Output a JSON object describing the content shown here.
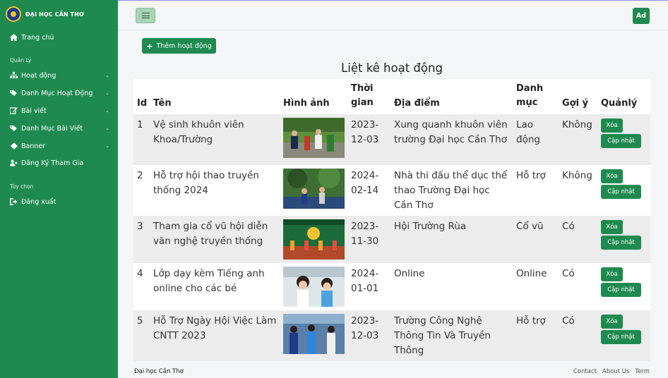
{
  "brand": {
    "name": "ĐẠI HỌC CẦN THƠ"
  },
  "sidebar": {
    "home": "Trang chủ",
    "section_manage": "Quản Lý",
    "items": [
      {
        "label": "Hoạt động",
        "icon": "sitemap-icon"
      },
      {
        "label": "Danh Mục Hoạt Động",
        "icon": "tag-icon"
      },
      {
        "label": "Bài viết",
        "icon": "edit-icon"
      },
      {
        "label": "Danh Mục Bài Viết",
        "icon": "tag-icon"
      },
      {
        "label": "Banner",
        "icon": "diamond-icon"
      },
      {
        "label": "Đăng Ký Tham Gia",
        "icon": "user-add-icon"
      }
    ],
    "section_options": "Tùy chọn",
    "logout": "Đăng xuất"
  },
  "topbar": {
    "avatar": "Ad"
  },
  "actions": {
    "add_label": "Thêm hoạt động"
  },
  "page": {
    "title": "Liệt kê hoạt động"
  },
  "table": {
    "headers": [
      "Id",
      "Tên",
      "Hình ảnh",
      "Thời gian",
      "Địa điểm",
      "Danh mục",
      "Gợi ý",
      "Quảnlý"
    ],
    "delete_label": "Xóa",
    "update_label": "Cập nhật",
    "rows": [
      {
        "id": "1",
        "name": "Vệ sinh khuôn viên Khoa/Trường",
        "time": "2023-12-03",
        "place": "Xung quanh khuôn viên trường Đại học Cần Thơ",
        "category": "Lao động",
        "suggest": "Không"
      },
      {
        "id": "2",
        "name": "Hỗ trợ hội thao truyền thống 2024",
        "time": "2024-02-14",
        "place": "Nhà thi đấu thể dục thể thao Trường Đại học Cần Thơ",
        "category": "Hỗ trợ",
        "suggest": "Không"
      },
      {
        "id": "3",
        "name": "Tham gia cổ vũ hội diễn văn nghệ truyền thống",
        "time": "2023-11-30",
        "place": "Hội Trường Rùa",
        "category": "Cổ vũ",
        "suggest": "Có"
      },
      {
        "id": "4",
        "name": "Lớp dạy kèm Tiếng anh online cho các bé",
        "time": "2024-01-01",
        "place": "Online",
        "category": "Online",
        "suggest": "Có"
      },
      {
        "id": "5",
        "name": "Hỗ Trợ Ngày Hội Việc Làm CNTT 2023",
        "time": "2023-12-03",
        "place": "Trường Công Nghệ Thông Tin Và Truyền Thông",
        "category": "Hỗ trợ",
        "suggest": "Có"
      }
    ]
  },
  "footer": {
    "left": "Đại học Cần Thơ",
    "links": [
      "Contact",
      "About Us",
      "Term"
    ]
  }
}
